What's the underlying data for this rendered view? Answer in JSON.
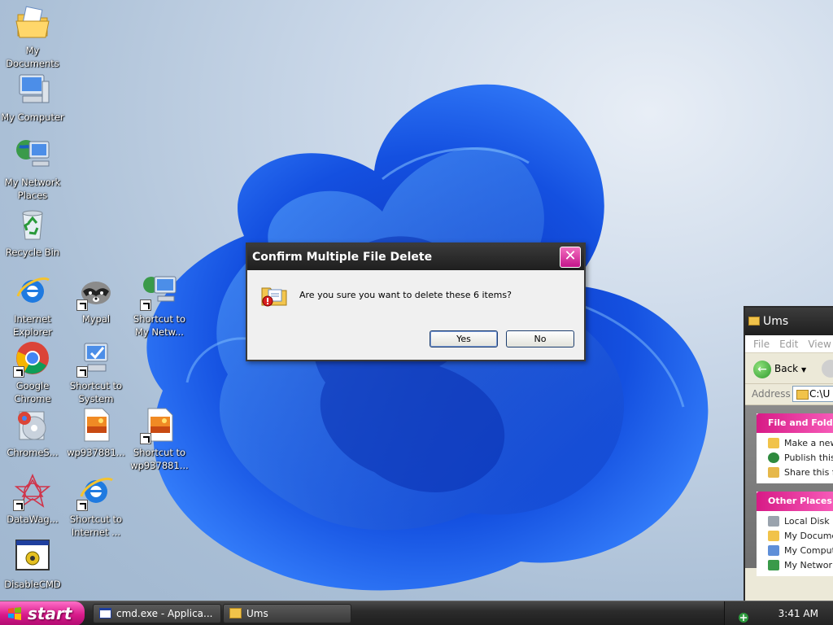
{
  "desktop": {
    "icons": [
      {
        "label": "My Documents",
        "icon": "folder-documents-icon"
      },
      {
        "label": "My Computer",
        "icon": "computer-icon"
      },
      {
        "label": "My Network Places",
        "icon": "network-places-icon"
      },
      {
        "label": "Recycle Bin",
        "icon": "recycle-bin-icon"
      },
      {
        "label": "Internet Explorer",
        "icon": "internet-explorer-icon"
      },
      {
        "label": "Mypal",
        "icon": "mypal-raccoon-icon"
      },
      {
        "label": "Shortcut to My Netw...",
        "icon": "network-shortcut-icon"
      },
      {
        "label": "Google Chrome",
        "icon": "chrome-icon"
      },
      {
        "label": "Shortcut to System",
        "icon": "system-shortcut-icon"
      },
      {
        "label": "ChromeS...",
        "icon": "chrome-setup-icon"
      },
      {
        "label": "wp937881...",
        "icon": "image-file-icon"
      },
      {
        "label": "Shortcut to wp937881...",
        "icon": "image-shortcut-icon"
      },
      {
        "label": "DataWag...",
        "icon": "datawag-icon"
      },
      {
        "label": "Shortcut to Internet ...",
        "icon": "ie-shortcut-icon"
      },
      {
        "label": "DisableCMD",
        "icon": "disablecmd-icon"
      }
    ]
  },
  "dialog": {
    "title": "Confirm Multiple File Delete",
    "message": "Are you sure you want to delete these 6 items?",
    "yes_label": "Yes",
    "no_label": "No",
    "close_symbol": "✕"
  },
  "explorer": {
    "title": "Ums",
    "menu": [
      "File",
      "Edit",
      "View"
    ],
    "back_label": "Back",
    "address_label": "Address",
    "address_value": "C:\\U",
    "file_tasks_header": "File and Folder Tasks",
    "file_tasks": [
      "Make a new folder",
      "Publish this folder to the Web",
      "Share this folder"
    ],
    "other_places_header": "Other Places",
    "other_places": [
      "Local Disk (C:)",
      "My Documents",
      "My Computer",
      "My Network Places"
    ]
  },
  "taskbar": {
    "start_label": "start",
    "tasks": [
      {
        "label": "cmd.exe - Applica...",
        "icon": "cmd-window-icon"
      },
      {
        "label": "Ums",
        "icon": "folder-icon"
      }
    ],
    "clock": "3:41 AM"
  },
  "colors": {
    "accent_pink": "#d81b8a",
    "title_dark": "#2a2a2a",
    "wallpaper_blue": "#1a5fe0"
  }
}
